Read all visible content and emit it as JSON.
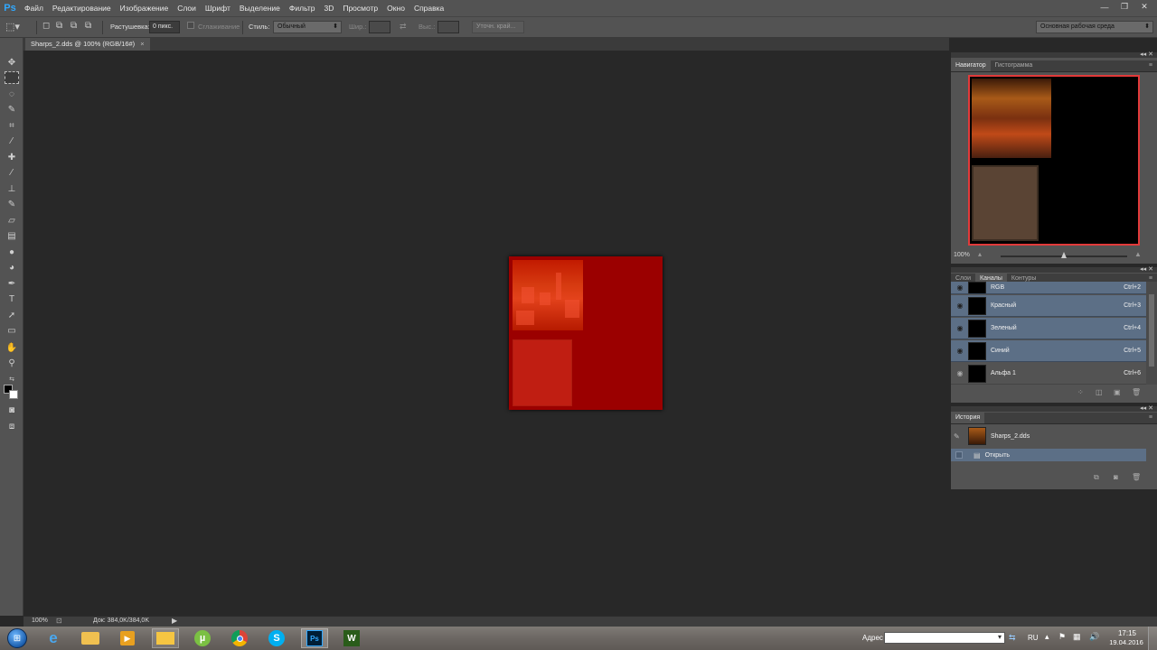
{
  "app": {
    "logo": "Ps"
  },
  "menu": [
    "Файл",
    "Редактирование",
    "Изображение",
    "Слои",
    "Шрифт",
    "Выделение",
    "Фильтр",
    "3D",
    "Просмотр",
    "Окно",
    "Справка"
  ],
  "window_controls": {
    "minimize": "—",
    "restore": "❐",
    "close": "✕"
  },
  "options": {
    "feather_label": "Растушевка:",
    "feather_value": "0 пикс.",
    "antialias_label": "Сглаживание",
    "style_label": "Стиль:",
    "style_value": "Обычный",
    "width_label": "Шир.:",
    "height_label": "Выс.:",
    "refine_edge": "Уточн. край...",
    "workspace": "Основная рабочая среда"
  },
  "document": {
    "tab_title": "Sharps_2.dds @ 100% (RGB/16#)",
    "close": "×"
  },
  "status": {
    "zoom": "100%",
    "doc_size": "Док: 384,0K/384,0K"
  },
  "navigator": {
    "tabs": [
      "Навигатор",
      "Гистограмма"
    ],
    "zoom": "100%"
  },
  "channels_panel": {
    "tabs": [
      "Слои",
      "Каналы",
      "Контуры"
    ],
    "rows": [
      {
        "name": "RGB",
        "shortcut": "Ctrl+2"
      },
      {
        "name": "Красный",
        "shortcut": "Ctrl+3"
      },
      {
        "name": "Зеленый",
        "shortcut": "Ctrl+4"
      },
      {
        "name": "Синий",
        "shortcut": "Ctrl+5"
      },
      {
        "name": "Альфа 1",
        "shortcut": "Ctrl+6"
      }
    ]
  },
  "history": {
    "title": "История",
    "snapshot": "Sharps_2.dds",
    "step": "Открыть"
  },
  "taskbar": {
    "address_label": "Адрес",
    "lang": "RU",
    "time": "17:15",
    "date": "19.04.2016",
    "apps": [
      "IE",
      "Explorer",
      "Media",
      "Folder",
      "uTorrent",
      "Chrome",
      "Skype",
      "Photoshop",
      "W"
    ]
  },
  "colors": {
    "accent_red": "#9b0000",
    "panel_bg": "#535353",
    "selected_row": "#5c6f86",
    "ps_blue": "#31a8ff"
  }
}
